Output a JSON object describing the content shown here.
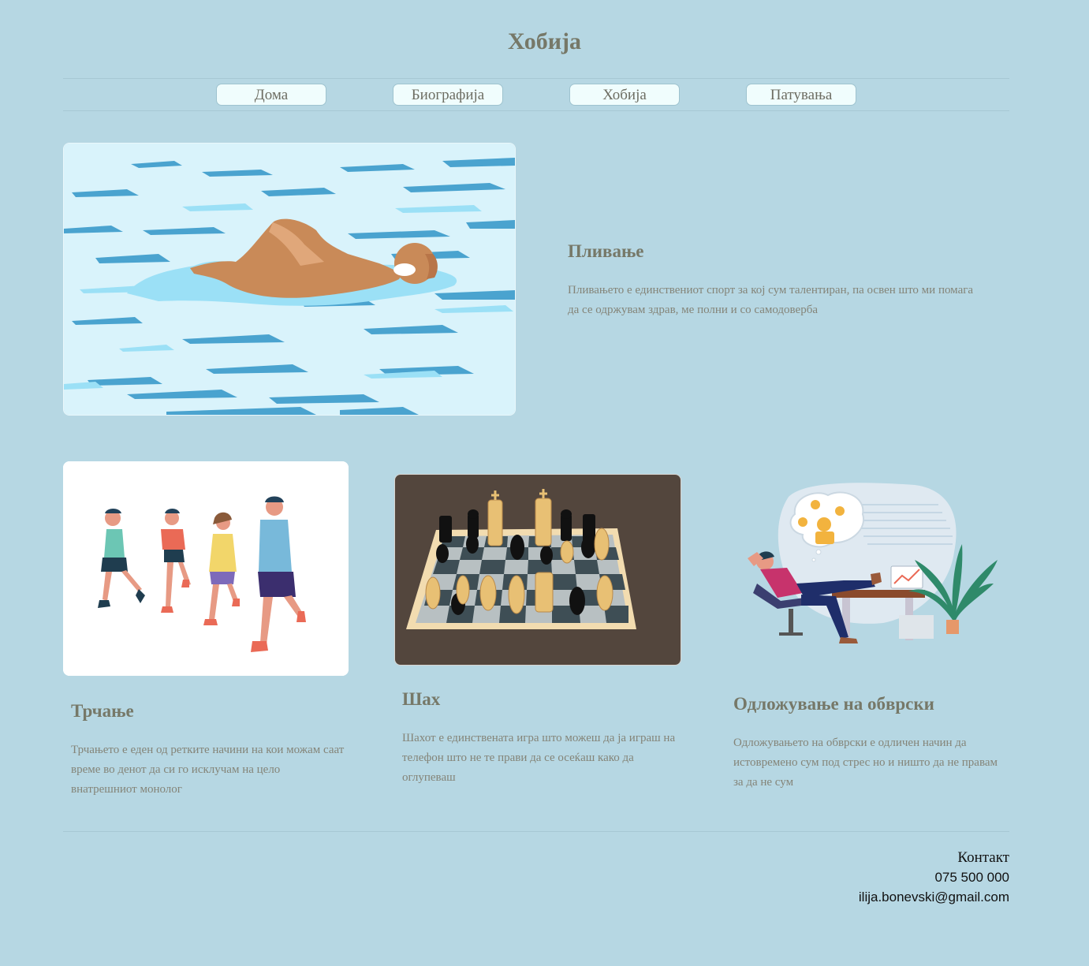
{
  "page": {
    "title": "Хобија"
  },
  "nav": {
    "items": [
      {
        "label": "Дома"
      },
      {
        "label": "Биографија"
      },
      {
        "label": "Хобија"
      },
      {
        "label": "Патувања"
      }
    ]
  },
  "hobbies": [
    {
      "title": "Пливање",
      "text": "Пливањето е единствениот спорт за кој сум талентиран, па освен што ми помага да се одржувам здрав, ме полни и со самодоверба"
    },
    {
      "title": "Трчање",
      "text": "Трчањето е еден од ретките начини на кои можам саат време во денот да си го исклучам на цело внатрешниот монолог"
    },
    {
      "title": "Шах",
      "text": "Шахот е единствената игра што можеш да ја играш на телефон што не те прави да се осеќаш како да оглупеваш"
    },
    {
      "title": "Одложување на обврски",
      "text": "Одложувањето на обврски е одличен начин да истовремено сум под стрес но и ништо да не правам за да не сум"
    }
  ],
  "footer": {
    "contact_title": "Контакт",
    "phone": "075 500 000",
    "email": "ilija.bonevski@gmail.com"
  },
  "colors": {
    "background": "#b6d7e3",
    "nav_button": "#f0fdfd",
    "heading": "#767868"
  }
}
